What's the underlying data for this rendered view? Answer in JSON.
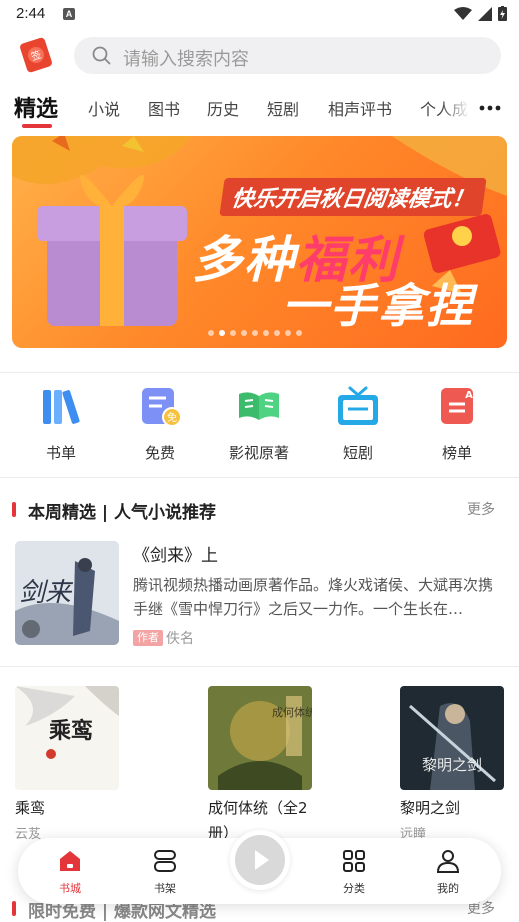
{
  "status_bar": {
    "time": "2:44",
    "notification_letter": "A"
  },
  "search": {
    "placeholder": "请输入搜索内容"
  },
  "tabs": [
    {
      "label": "精选",
      "active": true
    },
    {
      "label": "小说"
    },
    {
      "label": "图书"
    },
    {
      "label": "历史"
    },
    {
      "label": "短剧"
    },
    {
      "label": "相声评书"
    },
    {
      "label": "个人成"
    }
  ],
  "banner": {
    "line1": "快乐开启秋日阅读模式！",
    "line2_a": "多种",
    "line2_b": "福利",
    "line3": "一手拿捏",
    "dot_count": 9,
    "active_dot": 1
  },
  "quick_menu": [
    {
      "label": "书单",
      "icon": "book-list-icon"
    },
    {
      "label": "免费",
      "icon": "free-icon"
    },
    {
      "label": "影视原著",
      "icon": "open-book-icon"
    },
    {
      "label": "短剧",
      "icon": "tv-icon"
    },
    {
      "label": "榜单",
      "icon": "ranking-icon"
    }
  ],
  "section1": {
    "title": "本周精选 | 人气小说推荐",
    "more": "更多"
  },
  "featured": {
    "title": "《剑来》上",
    "description": "腾讯视频热播动画原著作品。烽火戏诸侯、大斌再次携手继《雪中悍刀行》之后又一力作。一个生长在…",
    "author_tag": "作者",
    "author": "佚名",
    "cover_text": "剑来"
  },
  "books": [
    {
      "title": "乘鸾",
      "author": "云芨",
      "cover_text": "乘鸾"
    },
    {
      "title": "成何体统（全2册）",
      "author": "",
      "cover_text": "成何体统"
    },
    {
      "title": "黎明之剑",
      "author": "远瞳",
      "cover_text": "黎明之剑"
    }
  ],
  "section2": {
    "title": "限时免费 | 爆款网文精选",
    "more": "更多"
  },
  "bottom_nav": {
    "items": [
      {
        "label": "书城",
        "icon": "home-icon",
        "active": true
      },
      {
        "label": "书架",
        "icon": "bookshelf-icon"
      },
      {
        "label": "分类",
        "icon": "category-icon"
      },
      {
        "label": "我的",
        "icon": "profile-icon"
      }
    ]
  },
  "colors": {
    "accent": "#e4353b",
    "banner": "#ff8a2a"
  }
}
